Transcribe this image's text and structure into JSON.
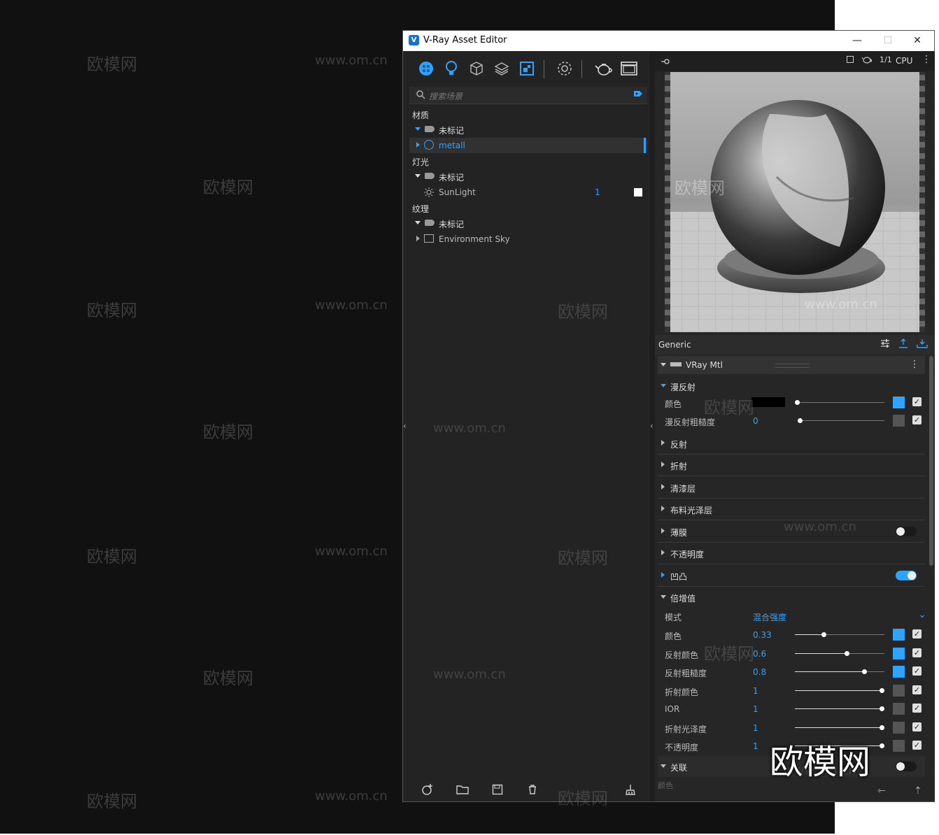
{
  "window": {
    "title": "V-Ray Asset Editor",
    "minimize": "—",
    "maximize": "☐",
    "close": "✕"
  },
  "watermarks": {
    "cn": "欧模网",
    "url": "www.om.cn"
  },
  "search": {
    "placeholder": "搜索场景"
  },
  "tree": {
    "materials_label": "材质",
    "materials_group": "未标记",
    "materials_item": "metall",
    "lights_label": "灯光",
    "lights_group": "未标记",
    "lights_item": "SunLight",
    "lights_item_count": "1",
    "textures_label": "纹理",
    "textures_group": "未标记",
    "textures_item": "Environment Sky"
  },
  "preview": {
    "pages": "1/1",
    "engine": "CPU"
  },
  "props": {
    "panel_title": "Generic",
    "material_type": "VRay Mtl",
    "diffuse": {
      "title": "漫反射",
      "color_label": "颜色",
      "roughness_label": "漫反射粗糙度",
      "roughness_value": "0"
    },
    "sections": {
      "reflection": "反射",
      "refraction": "折射",
      "coat": "清漆层",
      "sheen": "布料光泽层",
      "thinfilm": "薄膜",
      "opacity": "不透明度",
      "bump": "凹凸",
      "multipliers": "倍增值",
      "binding": "关联"
    },
    "multipliers": {
      "mode_label": "模式",
      "mode_value": "混合强度",
      "rows": [
        {
          "label": "颜色",
          "value": "0.33",
          "fraction": 0.33
        },
        {
          "label": "反射颜色",
          "value": "0.6",
          "fraction": 0.6
        },
        {
          "label": "反射粗糙度",
          "value": "0.8",
          "fraction": 0.8
        },
        {
          "label": "折射颜色",
          "value": "1",
          "fraction": 1
        },
        {
          "label": "IOR",
          "value": "1",
          "fraction": 1
        },
        {
          "label": "折射光泽度",
          "value": "1",
          "fraction": 1
        },
        {
          "label": "不透明度",
          "value": "1",
          "fraction": 1
        }
      ]
    },
    "binding_color_label": "颜色"
  },
  "brand": "欧模网",
  "colors": {
    "accent": "#2ea3ff",
    "panel": "#262626",
    "diffuse_color": "#000000"
  }
}
